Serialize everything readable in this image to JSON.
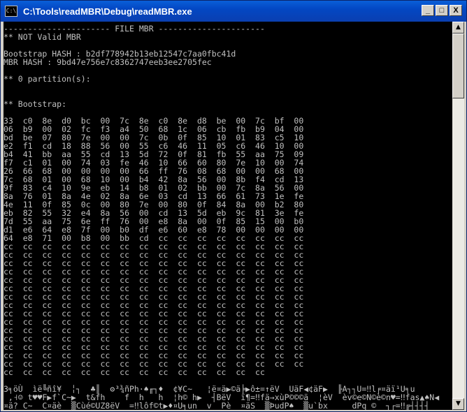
{
  "window": {
    "title": "C:\\Tools\\readMBR\\Debug\\readMBR.exe",
    "buttons": {
      "minimize": "_",
      "maximize": "□",
      "close": "X"
    }
  },
  "console": {
    "lines": [
      "---------------------- FILE MBR ----------------------",
      "** NOT Valid MBR",
      "",
      "Bootstrap HASH : b2df778942b13eb12547c7aa0fbc41d",
      "MBR HASH : 9bd47e756e7c8362747eeb3ee2705fec",
      "",
      "** 0 partition(s):",
      "",
      "",
      "** Bootstrap:",
      "",
      "33  c0  8e  d0  bc  00  7c  8e  c0  8e  d8  be  00  7c  bf  00",
      "06  b9  00  02  fc  f3  a4  50  68  1c  06  cb  fb  b9  04  00",
      "bd  be  07  80  7e  00  00  7c  0b  0f  85  10  01  83  c5  10",
      "e2  f1  cd  18  88  56  00  55  c6  46  11  05  c6  46  10  00",
      "b4  41  bb  aa  55  cd  13  5d  72  0f  81  fb  55  aa  75  09",
      "f7  c1  01  00  74  03  fe  46  10  66  60  80  7e  10  00  74",
      "26  66  68  00  00  00  00  66  ff  76  08  68  00  00  68  00",
      "7c  68  01  00  68  10  00  b4  42  8a  56  00  8b  f4  cd  13",
      "9f  83  c4  10  9e  eb  14  b8  01  02  bb  00  7c  8a  56  00",
      "8a  76  01  8a  4e  02  8a  6e  03  cd  13  66  61  73  1e  fe",
      "4e  11  0f  85  0c  00  80  7e  00  80  0f  84  8a  00  b2  80",
      "eb  82  55  32  e4  8a  56  00  cd  13  5d  eb  9c  81  3e  fe",
      "7d  55  aa  75  6e  ff  76  00  e8  8a  00  0f  85  15  00  b0",
      "d1  e6  64  e8  7f  00  b0  df  e6  60  e8  78  00  00  00  00",
      "64  e8  71  00  b8  00  bb  cd  cc  cc  cc  cc  cc  cc  cc  cc",
      "cc  cc  cc  cc  cc  cc  cc  cc  cc  cc  cc  cc  cc  cc  cc  cc",
      "cc  cc  cc  cc  cc  cc  cc  cc  cc  cc  cc  cc  cc  cc  cc  cc",
      "cc  cc  cc  cc  cc  cc  cc  cc  cc  cc  cc  cc  cc  cc  cc  cc",
      "cc  cc  cc  cc  cc  cc  cc  cc  cc  cc  cc  cc  cc  cc  cc  cc",
      "cc  cc  cc  cc  cc  cc  cc  cc  cc  cc  cc  cc  cc  cc  cc  cc",
      "cc  cc  cc  cc  cc  cc  cc  cc  cc  cc  cc  cc  cc  cc  cc  cc",
      "cc  cc  cc  cc  cc  cc  cc  cc  cc  cc  cc  cc  cc  cc  cc  cc",
      "cc  cc  cc  cc  cc  cc  cc  cc  cc  cc  cc  cc  cc  cc  cc  cc",
      "cc  cc  cc  cc  cc  cc  cc  cc  cc  cc  cc  cc  cc  cc  cc  cc",
      "cc  cc  cc  cc  cc  cc  cc  cc  cc  cc  cc  cc  cc  cc  cc  cc",
      "cc  cc  cc  cc  cc  cc  cc  cc  cc  cc  cc  cc  cc  cc  cc  cc",
      "cc  cc  cc  cc  cc  cc  cc  cc  cc  cc  cc  cc  cc  cc  cc  cc",
      "cc  cc  cc  cc  cc  cc  cc  cc  cc  cc  cc  cc  cc  cc  cc  cc",
      "cc  cc  cc  cc  cc  cc  cc  cc  cc  cc  cc  cc  cc  cc  cc  cc",
      "cc  cc  cc  cc  cc  cc  cc  cc  cc  cc  cc  cc  cc  cc  cc  cc",
      "cc  cc  cc  cc  cc  cc  cc  cc  cc  cc  cc  cc  cc  cc",
      "",
      "3╕öÙ  ìë╚ñî¥  ╎┐  ♣║  ⚙³¾ñPh·♠╓┐♦  ¢¥C~   ¦ë¤ä▶©ä╞▶ô±=↑ëV  UäF◀¢äF▶  ╟A┐┐U=‼l╒¤äï¹U╕u",
      " ,˧☺ t♥♥F▶f`C~▶  t&fh    f  h   h  ¦h© h▶  ┤BëV  ï¶=‼fä→xùP©©©ä  ¦èV  èv©e©N©è©n♥=‼fas▲♠N◀",
      "¤ä? C~  C¤äè  ▒Cùé©UZ8ëV  =‼lôf©t▶♦¤U╕un  v  Pè  ¤äS  ▒ÞudP♠  ▒u`bx     dPq ©  ┐┌=‼╔┤┤┤┤"
    ]
  }
}
